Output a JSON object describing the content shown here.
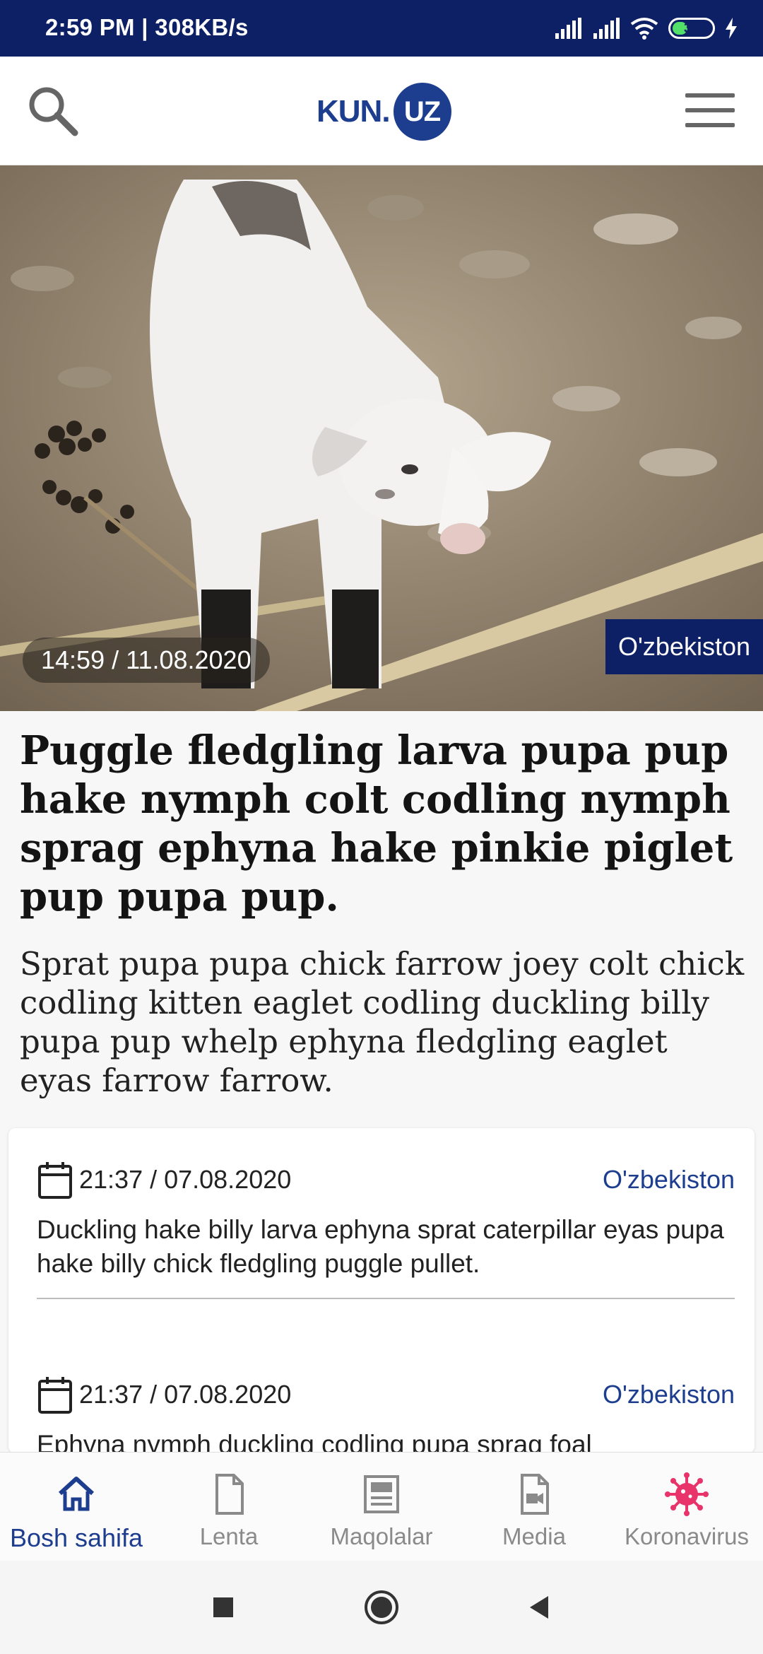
{
  "status_bar": {
    "time": "2:59 PM | 308KB/s",
    "battery": "39",
    "battery_level": 0.39,
    "icons": [
      "signal-icon",
      "signal-icon",
      "wifi-icon",
      "battery-icon",
      "charging-icon"
    ]
  },
  "header": {
    "logo_left": "KUN",
    "logo_dot": ".",
    "logo_right": "UZ",
    "search_icon": "search-icon",
    "menu_icon": "hamburger-menu-icon"
  },
  "hero": {
    "time": "14:59 / 11.08.2020",
    "category": "O'zbekiston"
  },
  "article": {
    "title": "Puggle fledgling larva pupa pup hake nymph colt codling nymph sprag ephyna hake pinkie piglet pup pupa pup.",
    "lead": "Sprat pupa pupa chick farrow joey colt chick codling kitten eaglet codling duckling billy pupa pup whelp ephyna fledgling eaglet eyas farrow farrow."
  },
  "news": [
    {
      "date": "21:37 / 07.08.2020",
      "category": "O'zbekiston",
      "text": "Duckling hake billy larva ephyna sprat caterpillar eyas pupa hake billy chick fledgling puggle pullet."
    },
    {
      "date": "21:37 / 07.08.2020",
      "category": "O'zbekiston",
      "text": "Ephyna nymph duckling codling pupa sprag foal"
    }
  ],
  "bottom_nav": [
    {
      "label": "Bosh sahifa",
      "icon": "home-icon",
      "active": true
    },
    {
      "label": "Lenta",
      "icon": "document-icon",
      "active": false
    },
    {
      "label": "Maqolalar",
      "icon": "articles-icon",
      "active": false
    },
    {
      "label": "Media",
      "icon": "video-file-icon",
      "active": false
    },
    {
      "label": "Koronavirus",
      "icon": "virus-icon",
      "active": false
    }
  ],
  "colors": {
    "brand": "#1d3d8f",
    "status_bar": "#0e2065",
    "virus": "#e8336b"
  }
}
